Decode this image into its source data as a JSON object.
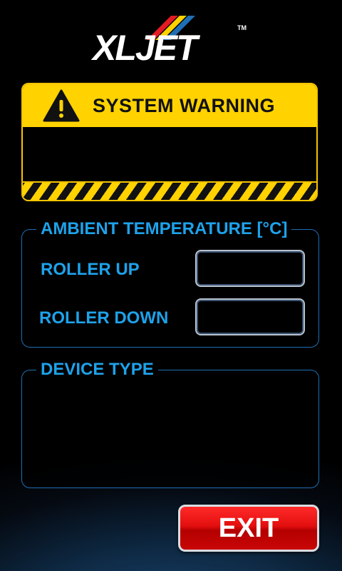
{
  "logo": {
    "text": "XLJET",
    "trademark": "TM"
  },
  "warning": {
    "title": "SYSTEM WARNING",
    "message": "",
    "icon": "warning-triangle-icon",
    "color": "#ffd200"
  },
  "ambient": {
    "legend": "AMBIENT TEMPERATURE [°C]",
    "roller_up_label": "ROLLER UP",
    "roller_up_value": "",
    "roller_down_label": "ROLLER DOWN",
    "roller_down_value": ""
  },
  "device": {
    "legend": "DEVICE TYPE",
    "value": ""
  },
  "exit": {
    "label": "EXIT",
    "color": "#e30f0f"
  },
  "colors": {
    "accent": "#1ea2ea",
    "border": "#1e6fb5",
    "background": "#000000"
  }
}
